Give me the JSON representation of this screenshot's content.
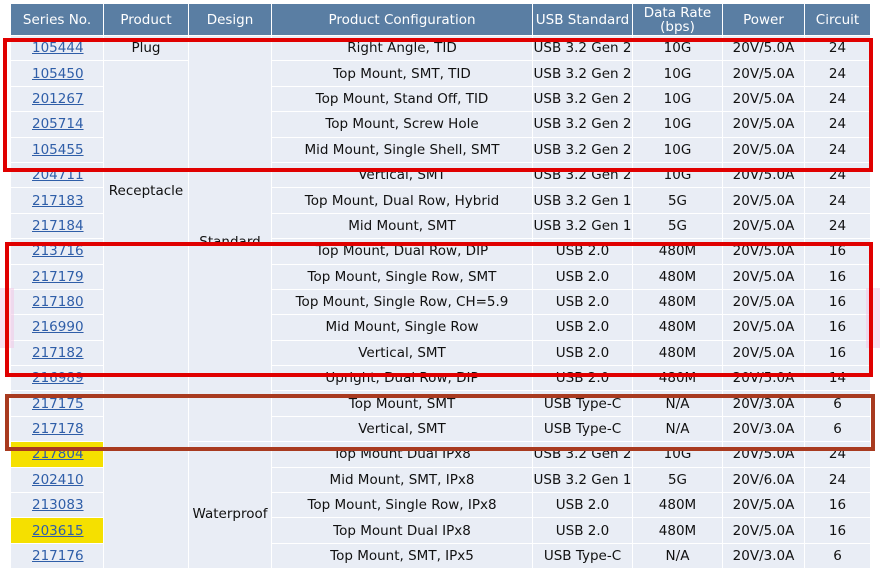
{
  "headers": {
    "series": "Series No.",
    "product": "Product",
    "design": "Design",
    "config": "Product Configuration",
    "usb": "USB Standard",
    "rate_line1": "Data Rate",
    "rate_line2": "(bps)",
    "power": "Power",
    "circuit": "Circuit"
  },
  "groups": {
    "plug": "Plug",
    "receptacle": "Receptacle",
    "standard": "Standard",
    "waterproof": "Waterproof"
  },
  "rows": [
    {
      "series": "105444",
      "config": "Right Angle, TID",
      "usb": "USB 3.2 Gen 2",
      "rate": "10G",
      "power": "20V/5.0A",
      "circuit": "24"
    },
    {
      "series": "105450",
      "config": "Top Mount, SMT, TID",
      "usb": "USB 3.2 Gen 2",
      "rate": "10G",
      "power": "20V/5.0A",
      "circuit": "24"
    },
    {
      "series": "201267",
      "config": "Top Mount, Stand Off, TID",
      "usb": "USB 3.2 Gen 2",
      "rate": "10G",
      "power": "20V/5.0A",
      "circuit": "24"
    },
    {
      "series": "205714",
      "config": "Top Mount, Screw Hole",
      "usb": "USB 3.2 Gen 2",
      "rate": "10G",
      "power": "20V/5.0A",
      "circuit": "24"
    },
    {
      "series": "105455",
      "config": "Mid Mount, Single Shell, SMT",
      "usb": "USB 3.2 Gen 2",
      "rate": "10G",
      "power": "20V/5.0A",
      "circuit": "24"
    },
    {
      "series": "204711",
      "config": "Vertical, SMT",
      "usb": "USB 3.2 Gen 2",
      "rate": "10G",
      "power": "20V/5.0A",
      "circuit": "24"
    },
    {
      "series": "217183",
      "config": "Top Mount, Dual Row, Hybrid",
      "usb": "USB 3.2 Gen 1",
      "rate": "5G",
      "power": "20V/5.0A",
      "circuit": "24"
    },
    {
      "series": "217184",
      "config": "Mid Mount, SMT",
      "usb": "USB 3.2 Gen 1",
      "rate": "5G",
      "power": "20V/5.0A",
      "circuit": "24"
    },
    {
      "series": "213716",
      "config": "Top Mount, Dual Row, DIP",
      "usb": "USB 2.0",
      "rate": "480M",
      "power": "20V/5.0A",
      "circuit": "16"
    },
    {
      "series": "217179",
      "config": "Top Mount, Single Row, SMT",
      "usb": "USB 2.0",
      "rate": "480M",
      "power": "20V/5.0A",
      "circuit": "16"
    },
    {
      "series": "217180",
      "config": "Top Mount, Single Row, CH=5.9",
      "usb": "USB 2.0",
      "rate": "480M",
      "power": "20V/5.0A",
      "circuit": "16"
    },
    {
      "series": "216990",
      "config": "Mid Mount, Single Row",
      "usb": "USB 2.0",
      "rate": "480M",
      "power": "20V/5.0A",
      "circuit": "16"
    },
    {
      "series": "217182",
      "config": "Vertical, SMT",
      "usb": "USB 2.0",
      "rate": "480M",
      "power": "20V/5.0A",
      "circuit": "16"
    },
    {
      "series": "216989",
      "config": "Upright, Dual Row, DIP",
      "usb": "USB 2.0",
      "rate": "480M",
      "power": "20V/5.0A",
      "circuit": "14"
    },
    {
      "series": "217175",
      "config": "Top Mount, SMT",
      "usb": "USB Type-C",
      "rate": "N/A",
      "power": "20V/3.0A",
      "circuit": "6"
    },
    {
      "series": "217178",
      "config": "Vertical, SMT",
      "usb": "USB Type-C",
      "rate": "N/A",
      "power": "20V/3.0A",
      "circuit": "6"
    },
    {
      "series": "217804",
      "config": "Top Mount Dual IPx8",
      "usb": "USB 3.2 Gen 2",
      "rate": "10G",
      "power": "20V/5.0A",
      "circuit": "24"
    },
    {
      "series": "202410",
      "config": "Mid Mount, SMT, IPx8",
      "usb": "USB 3.2 Gen 1",
      "rate": "5G",
      "power": "20V/6.0A",
      "circuit": "24"
    },
    {
      "series": "213083",
      "config": "Top Mount, Single Row, IPx8",
      "usb": "USB 2.0",
      "rate": "480M",
      "power": "20V/5.0A",
      "circuit": "16"
    },
    {
      "series": "203615",
      "config": "Top Mount Dual IPx8",
      "usb": "USB 2.0",
      "rate": "480M",
      "power": "20V/5.0A",
      "circuit": "16"
    },
    {
      "series": "217176",
      "config": "Top Mount, SMT, IPx5",
      "usb": "USB Type-C",
      "rate": "N/A",
      "power": "20V/3.0A",
      "circuit": "6"
    }
  ],
  "highlight_color": "#f5e000",
  "box_color_red": "#e00000",
  "box_color_dark": "#a83a1f"
}
